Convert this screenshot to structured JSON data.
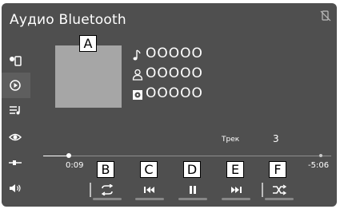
{
  "header": {
    "title": "Аудио Bluetooth",
    "status_icon": "no-phone-signal-icon"
  },
  "sidebar": {
    "items": [
      {
        "icon": "phone-device-icon",
        "active": false
      },
      {
        "icon": "play-source-icon",
        "active": true
      },
      {
        "icon": "playlist-icon",
        "active": false
      },
      {
        "icon": "eye-icon",
        "active": false
      },
      {
        "icon": "equalizer-slider-icon",
        "active": false
      },
      {
        "icon": "volume-icon",
        "active": false
      }
    ]
  },
  "now_playing": {
    "song": "OOOOO",
    "artist": "OOOOO",
    "album": "OOOOO",
    "track_label": "Трек",
    "track_number": "3",
    "elapsed": "0:09",
    "remaining": "-5:06",
    "progress": 0.09
  },
  "callouts": {
    "a": "A",
    "b": "B",
    "c": "C",
    "d": "D",
    "e": "E",
    "f": "F"
  },
  "controls": [
    {
      "icon": "repeat-icon"
    },
    {
      "icon": "previous-track-icon"
    },
    {
      "icon": "pause-icon"
    },
    {
      "icon": "next-track-icon"
    },
    {
      "icon": "shuffle-icon"
    }
  ],
  "colors": {
    "background": "#4f4f4f",
    "text": "#ffffff",
    "album_art_placeholder": "#a6a6a6"
  }
}
